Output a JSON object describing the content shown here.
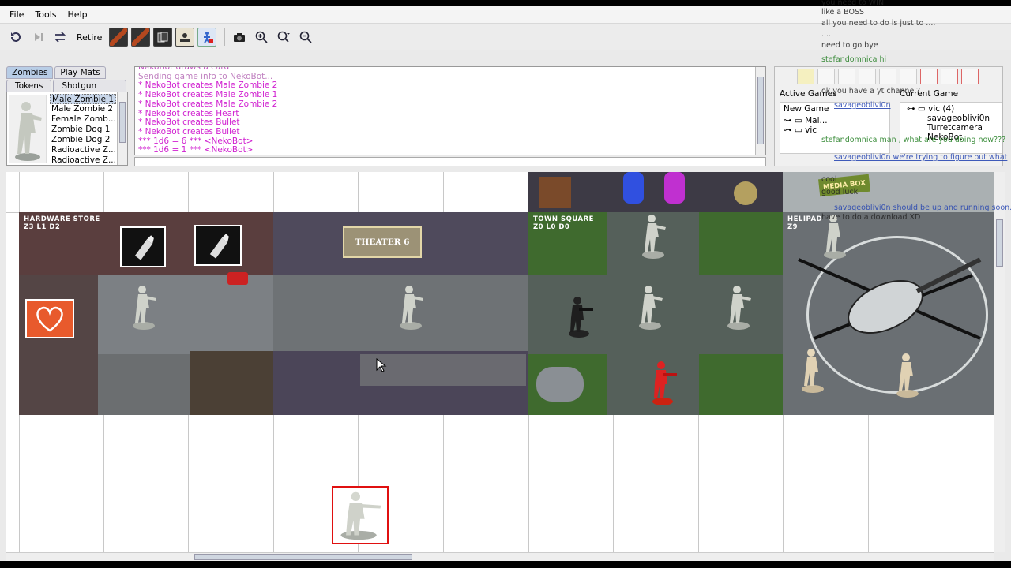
{
  "menu": {
    "items": [
      "File",
      "Tools",
      "Help"
    ]
  },
  "toolbar": {
    "retire_label": "Retire"
  },
  "piece_tabs": {
    "row1": [
      "Zombies",
      "Play Mats"
    ],
    "row2": [
      "Tokens",
      "Shotgun Guys"
    ],
    "active": "Zombies"
  },
  "piece_list": {
    "items": [
      "Male Zombie 1",
      "Male Zombie 2",
      "Female Zomb...",
      "Zombie Dog 1",
      "Zombie Dog 2",
      "Radioactive Z...",
      "Radioactive Z..."
    ],
    "selected_index": 0
  },
  "chat_log": {
    "lines": [
      {
        "text": "NekoBot draws a card",
        "color": "#c050c0"
      },
      {
        "text": "Sending game info to NekoBot...",
        "color": "#c080c0"
      },
      {
        "text": "* NekoBot creates Male Zombie 2",
        "color": "#d020d0"
      },
      {
        "text": "* NekoBot creates Male Zombie 1",
        "color": "#d020d0"
      },
      {
        "text": "* NekoBot creates Male Zombie 2",
        "color": "#d020d0"
      },
      {
        "text": "* NekoBot creates Heart",
        "color": "#d020d0"
      },
      {
        "text": "* NekoBot creates Bullet",
        "color": "#d020d0"
      },
      {
        "text": "* NekoBot creates Bullet",
        "color": "#d020d0"
      },
      {
        "text": "*** 1d6 = 6 *** <NekoBot>",
        "color": "#d020d0"
      },
      {
        "text": "*** 1d6 = 1 *** <NekoBot>",
        "color": "#d020d0"
      }
    ]
  },
  "game_panel": {
    "active_games_label": "Active Games",
    "new_game_label": "New Game",
    "current_game_label": "Current Game",
    "active_tree": [
      "Mai...",
      "vic"
    ],
    "current_tree": [
      "vic (4)",
      "savageoblivi0n",
      "Turretcamera",
      "NekoBot"
    ]
  },
  "tiles": [
    {
      "label": "HARDWARE STORE",
      "code": "Z3 L1 D2"
    },
    {
      "label": "THEATER 6",
      "code": ""
    },
    {
      "label": "TOWN SQUARE",
      "code": "Z0 L0 D0"
    },
    {
      "label": "HELIPAD",
      "code": "Z9"
    }
  ],
  "theater_sign": "THEATER 6",
  "media_box_sign": "MEDIA BOX",
  "stream_overlay": {
    "lines": [
      {
        "text": "you need to WIN",
        "style": "plain"
      },
      {
        "text": "like a BOSS",
        "style": "plain"
      },
      {
        "text": "all you need to do is just to ....",
        "style": "plain"
      },
      {
        "text": "....",
        "style": "plain"
      },
      {
        "text": "need to go bye",
        "style": "plain"
      },
      {
        "text": "stefandomnica hi",
        "style": "green"
      },
      {
        "text": "ok you have a yt channel?",
        "style": "plain"
      },
      {
        "text": "savageoblivi0n",
        "style": "blue"
      },
      {
        "text": "stefandomnica man , what are you doing now???",
        "style": "green"
      },
      {
        "text": "savageoblivi0n we're trying to figure out what",
        "style": "blue"
      },
      {
        "text": "cool",
        "style": "plain"
      },
      {
        "text": "good luck",
        "style": "plain"
      },
      {
        "text": "savageoblivi0n should be up and running soon.",
        "style": "blue"
      },
      {
        "text": "have to do a download XD",
        "style": "plain"
      }
    ]
  },
  "colors": {
    "chat_magenta": "#d020d0",
    "selection_blue": "#c9d7ea",
    "selected_piece_border": "#e01010"
  }
}
